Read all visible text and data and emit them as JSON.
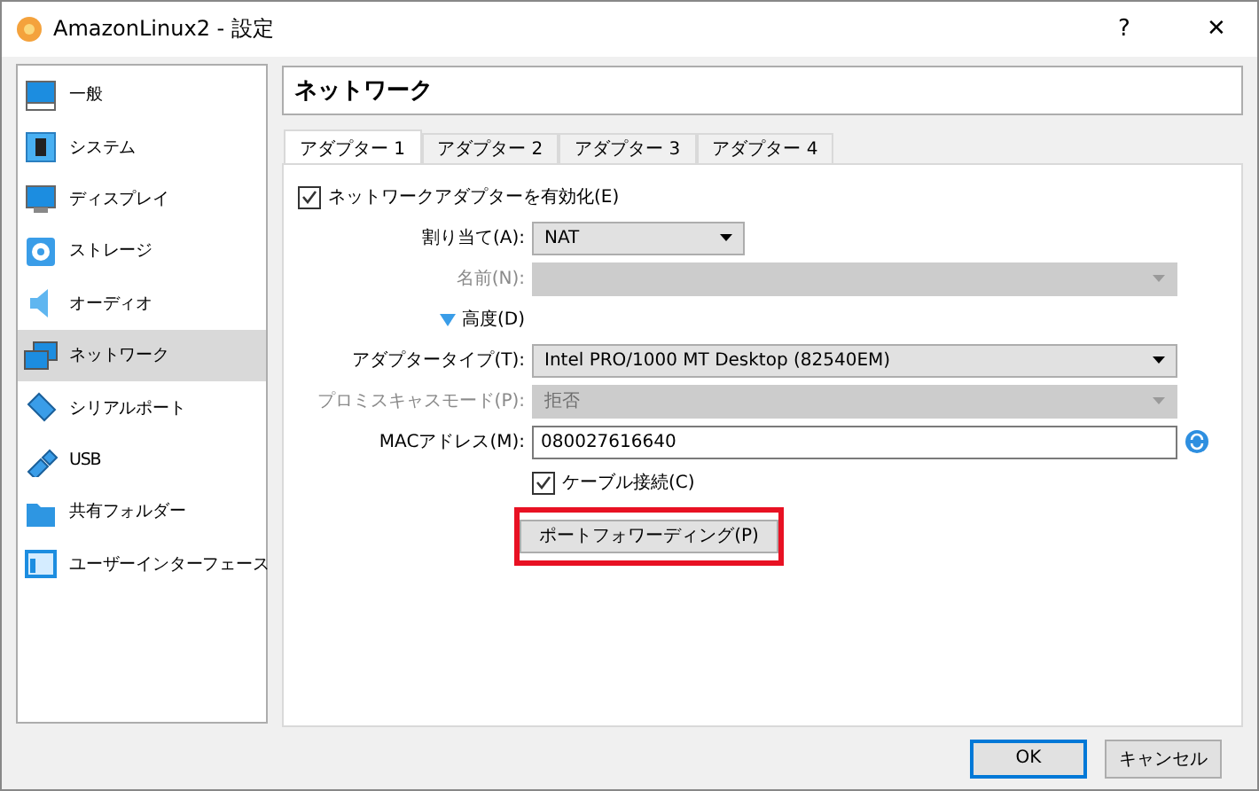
{
  "window": {
    "title": "AmazonLinux2 - 設定",
    "help": "?",
    "close": "✕"
  },
  "sidebar": {
    "items": [
      {
        "label": "一般",
        "selected": false
      },
      {
        "label": "システム",
        "selected": false
      },
      {
        "label": "ディスプレイ",
        "selected": false
      },
      {
        "label": "ストレージ",
        "selected": false
      },
      {
        "label": "オーディオ",
        "selected": false
      },
      {
        "label": "ネットワーク",
        "selected": true
      },
      {
        "label": "シリアルポート",
        "selected": false
      },
      {
        "label": "USB",
        "selected": false
      },
      {
        "label": "共有フォルダー",
        "selected": false
      },
      {
        "label": "ユーザーインターフェース",
        "selected": false
      }
    ]
  },
  "header": "ネットワーク",
  "tabs": [
    {
      "label": "アダプター 1",
      "selected": true
    },
    {
      "label": "アダプター 2",
      "selected": false
    },
    {
      "label": "アダプター 3",
      "selected": false
    },
    {
      "label": "アダプター 4",
      "selected": false
    }
  ],
  "form": {
    "enable": {
      "label": "ネットワークアダプターを有効化(E)",
      "checked": true
    },
    "rows": [
      {
        "kind": "select",
        "label": "割り当て(A):",
        "value": "NAT",
        "disabled": false,
        "short": true
      },
      {
        "kind": "select",
        "label": "名前(N):",
        "disabled": true
      },
      {
        "kind": "toggle",
        "label": "高度(D)",
        "expanded": true
      },
      {
        "kind": "select",
        "label": "アダプタータイプ(T):",
        "value": "Intel PRO/1000 MT Desktop (82540EM)",
        "disabled": false
      },
      {
        "kind": "select",
        "label": "プロミスキャスモード(P):",
        "value": "拒否",
        "disabled": true
      },
      {
        "kind": "text",
        "label": "MACアドレス(M):",
        "value": "080027616640"
      },
      {
        "kind": "check",
        "label": "ケーブル接続(C)",
        "checked": true
      },
      {
        "kind": "button",
        "label": "ポートフォワーディング(P)",
        "highlighted": true
      }
    ]
  },
  "buttons": [
    {
      "label": "OK",
      "default": true
    },
    {
      "label": "キャンセル",
      "default": false
    }
  ]
}
